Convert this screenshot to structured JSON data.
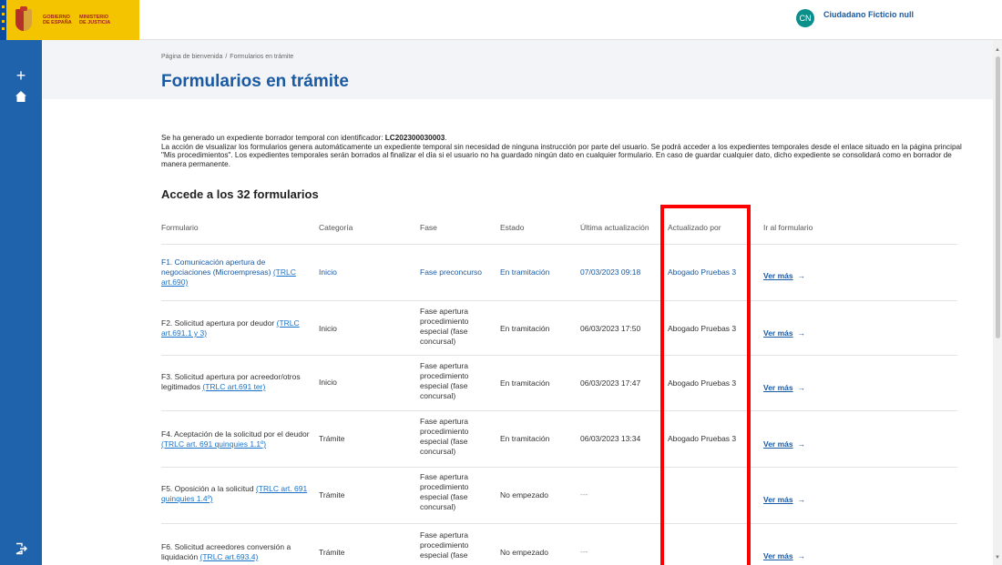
{
  "header": {
    "gov_label": "GOBIERNO DE ESPAÑA",
    "ministry_label": "MINISTERIO DE JUSTICIA",
    "user_initials": "CN",
    "user_name": "Ciudadano Ficticio null"
  },
  "breadcrumb": [
    "Página de bienvenida",
    "Formularios en trámite"
  ],
  "page_title": "Formularios en trámite",
  "info": {
    "line1_prefix": "Se ha generado un expediente borrador temporal con identificador: ",
    "expediente_id": "LC202300030003",
    "line1_suffix": ".",
    "body": "La acción de visualizar los formularios genera automáticamente un expediente temporal sin necesidad de ninguna instrucción por parte del usuario. Se podrá acceder a los expedientes temporales desde el enlace situado en la página principal \"Mis procedimientos\". Los expedientes temporales serán borrados al finalizar el día si el usuario no ha guardado ningún dato en cualquier formulario. En caso de guardar cualquier dato, dicho expediente se consolidará como en borrador de manera permanente."
  },
  "section_title": "Accede a los 32 formularios",
  "table": {
    "headers": [
      "Formulario",
      "Categoría",
      "Fase",
      "Estado",
      "Última actualización",
      "Actualizado por",
      "Ir al formulario"
    ],
    "rows": [
      {
        "name": "F1. Comunicación apertura de negociaciones (Microempresas) ",
        "link": "(TRLC art.690)",
        "categoria": "Inicio",
        "fase": "Fase preconcurso",
        "estado": "En tramitación",
        "fecha": "07/03/2023 09:18",
        "por": "Abogado Pruebas 3",
        "ver": "Ver más"
      },
      {
        "name": "F2. Solicitud apertura por deudor ",
        "link": "(TRLC art.691.1 y 3)",
        "categoria": "Inicio",
        "fase": "Fase apertura procedimiento especial (fase concursal)",
        "estado": "En tramitación",
        "fecha": "06/03/2023 17:50",
        "por": "Abogado Pruebas 3",
        "ver": "Ver más"
      },
      {
        "name": "F3. Solicitud apertura por acreedor/otros legitimados ",
        "link": "(TRLC art.691 ter)",
        "categoria": "Inicio",
        "fase": "Fase apertura procedimiento especial (fase concursal)",
        "estado": "En tramitación",
        "fecha": "06/03/2023 17:47",
        "por": "Abogado Pruebas 3",
        "ver": "Ver más"
      },
      {
        "name": "F4. Aceptación de la solicitud por el deudor ",
        "link": "(TRLC art. 691 quinquies 1.1º)",
        "categoria": "Trámite",
        "fase": "Fase apertura procedimiento especial (fase concursal)",
        "estado": "En tramitación",
        "fecha": "06/03/2023 13:34",
        "por": "Abogado Pruebas 3",
        "ver": "Ver más"
      },
      {
        "name": "F5. Oposición a la solicitud ",
        "link": "(TRLC art. 691 quinquies 1.4º)",
        "categoria": "Trámite",
        "fase": "Fase apertura procedimiento especial (fase concursal)",
        "estado": "No empezado",
        "fecha": "---",
        "por": "",
        "ver": "Ver más"
      },
      {
        "name": "F6. Solicitud acreedores conversión a liquidación ",
        "link": "(TRLC art.693.4)",
        "categoria": "Trámite",
        "fase": "Fase apertura procedimiento especial (fase",
        "estado": "No empezado",
        "fecha": "---",
        "por": "",
        "ver": "Ver más"
      }
    ]
  },
  "colors": {
    "sidebar": "#1f63ad",
    "accent": "#1a5aa3",
    "highlight": "#ff0000",
    "logo_bg": "#f4c400"
  },
  "icons": {
    "sidebar": [
      "plus-icon",
      "home-icon",
      "logout-icon"
    ],
    "link": "arrow-right-icon"
  }
}
